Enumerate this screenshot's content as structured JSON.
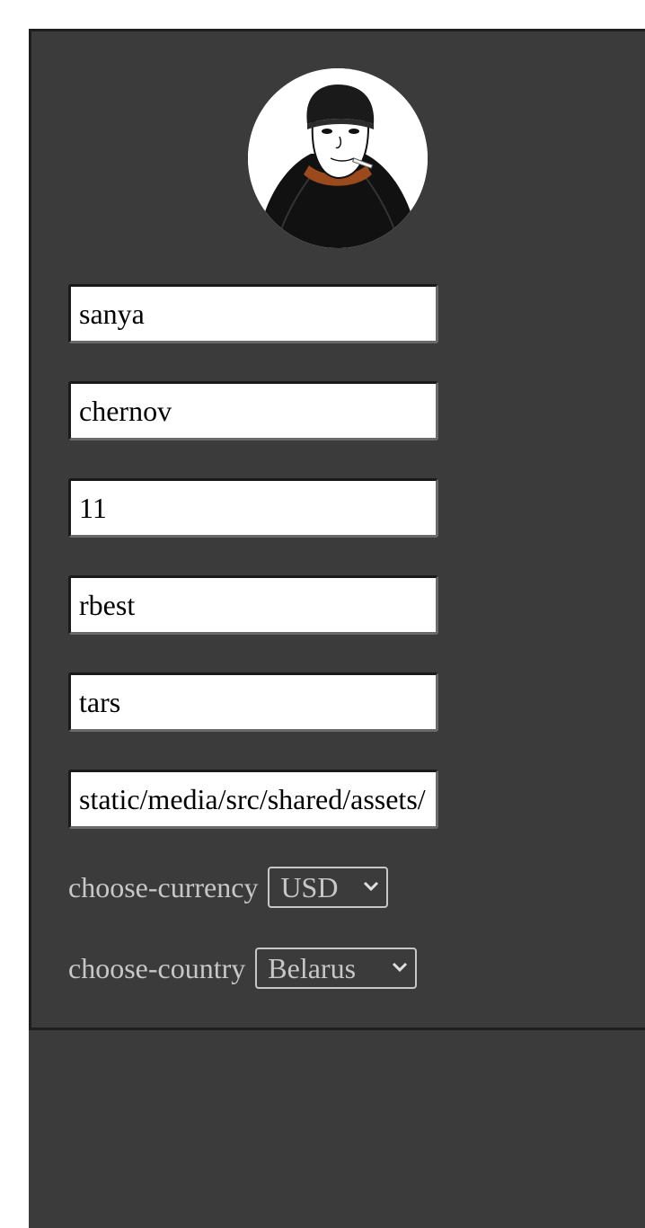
{
  "profile": {
    "avatar": {
      "description_icon": "avatar-doomer-icon"
    },
    "fields": [
      {
        "name": "first-name-input",
        "value": "sanya"
      },
      {
        "name": "last-name-input",
        "value": "chernov"
      },
      {
        "name": "age-input",
        "value": "11"
      },
      {
        "name": "username-input",
        "value": "rbest"
      },
      {
        "name": "password-input",
        "value": "tars"
      },
      {
        "name": "avatar-path-input",
        "value": "static/media/src/shared/assets/"
      }
    ],
    "currency": {
      "label": "choose-currency",
      "selected": "USD"
    },
    "country": {
      "label": "choose-country",
      "selected": "Belarus"
    }
  },
  "colors": {
    "panel_bg": "#3b3b3b",
    "panel_border": "#1e1e1e",
    "label_text": "#c7c7c7",
    "input_bg": "#ffffff"
  }
}
